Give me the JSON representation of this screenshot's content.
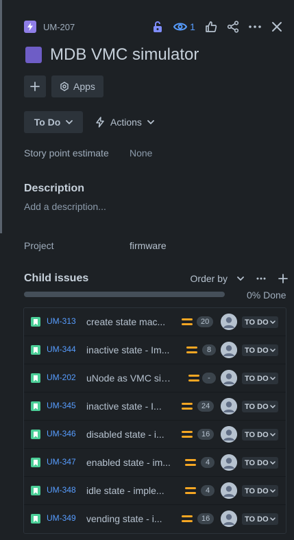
{
  "header": {
    "issue_key": "UM-207",
    "watch_count": "1",
    "icons": [
      "lightning-icon",
      "unlock-icon",
      "eye-icon",
      "thumbs-up-icon",
      "share-icon",
      "more-icon",
      "close-icon"
    ]
  },
  "title": "MDB VMC simulator",
  "buttons": {
    "apps_label": "Apps"
  },
  "status": {
    "label": "To Do",
    "actions_label": "Actions"
  },
  "fields": {
    "story_points_label": "Story point estimate",
    "story_points_value": "None",
    "project_label": "Project",
    "project_value": "firmware"
  },
  "description": {
    "title": "Description",
    "placeholder": "Add a description..."
  },
  "child_issues": {
    "title": "Child issues",
    "order_by_label": "Order by",
    "progress_percent": 0,
    "progress_label": "0% Done",
    "items": [
      {
        "key": "UM-313",
        "summary": "create state mac...",
        "points": "20",
        "status": "TO DO"
      },
      {
        "key": "UM-344",
        "summary": "inactive state - Im...",
        "points": "8",
        "status": "TO DO"
      },
      {
        "key": "UM-202",
        "summary": "uNode as VMC sim...",
        "points": "-",
        "status": "TO DO"
      },
      {
        "key": "UM-345",
        "summary": "inactive state - I...",
        "points": "24",
        "status": "TO DO"
      },
      {
        "key": "UM-346",
        "summary": "disabled state - i...",
        "points": "16",
        "status": "TO DO"
      },
      {
        "key": "UM-347",
        "summary": "enabled state - im...",
        "points": "4",
        "status": "TO DO"
      },
      {
        "key": "UM-348",
        "summary": "idle state - imple...",
        "points": "4",
        "status": "TO DO"
      },
      {
        "key": "UM-349",
        "summary": "vending state - i...",
        "points": "16",
        "status": "TO DO"
      }
    ]
  },
  "colors": {
    "background": "#1d2125",
    "accent_blue": "#579dff",
    "epic_purple": "#6e5dc6",
    "story_green": "#4bce97",
    "priority_orange": "#f5a623"
  }
}
